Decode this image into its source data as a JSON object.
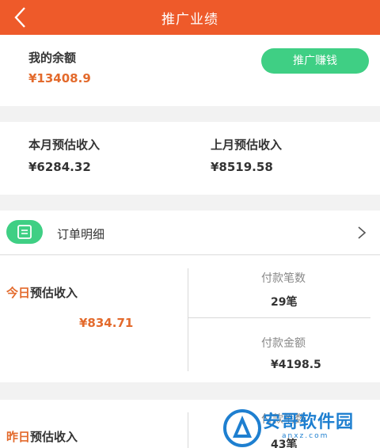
{
  "header": {
    "title": "推广业绩",
    "back_icon": "chevron-left-icon"
  },
  "balance": {
    "label": "我的余额",
    "value": "¥13408.9",
    "promo_button": "推广赚钱"
  },
  "month": {
    "this_label": "本月预估收入",
    "this_value": "¥6284.32",
    "last_label": "上月预估收入",
    "last_value": "¥8519.58"
  },
  "orders": {
    "icon": "list-icon",
    "label": "订单明细",
    "chevron": "chevron-right-icon"
  },
  "today": {
    "label_prefix": "今日",
    "label_suffix": "预估收入",
    "value": "¥834.71",
    "pay_count_label": "付款笔数",
    "pay_count_value": "29笔",
    "pay_amount_label": "付款金额",
    "pay_amount_value": "¥4198.5"
  },
  "yesterday": {
    "label_prefix": "昨日",
    "label_suffix": "预估收入",
    "pay_count_label": "付款笔数",
    "pay_count_value": "43笔"
  },
  "watermark": {
    "text": "安哥软件园",
    "url": "anxz.com"
  },
  "colors": {
    "header": "#ee5a2a",
    "accent": "#e36a2c",
    "green": "#3fcf84",
    "watermark": "#1e7fd0"
  }
}
